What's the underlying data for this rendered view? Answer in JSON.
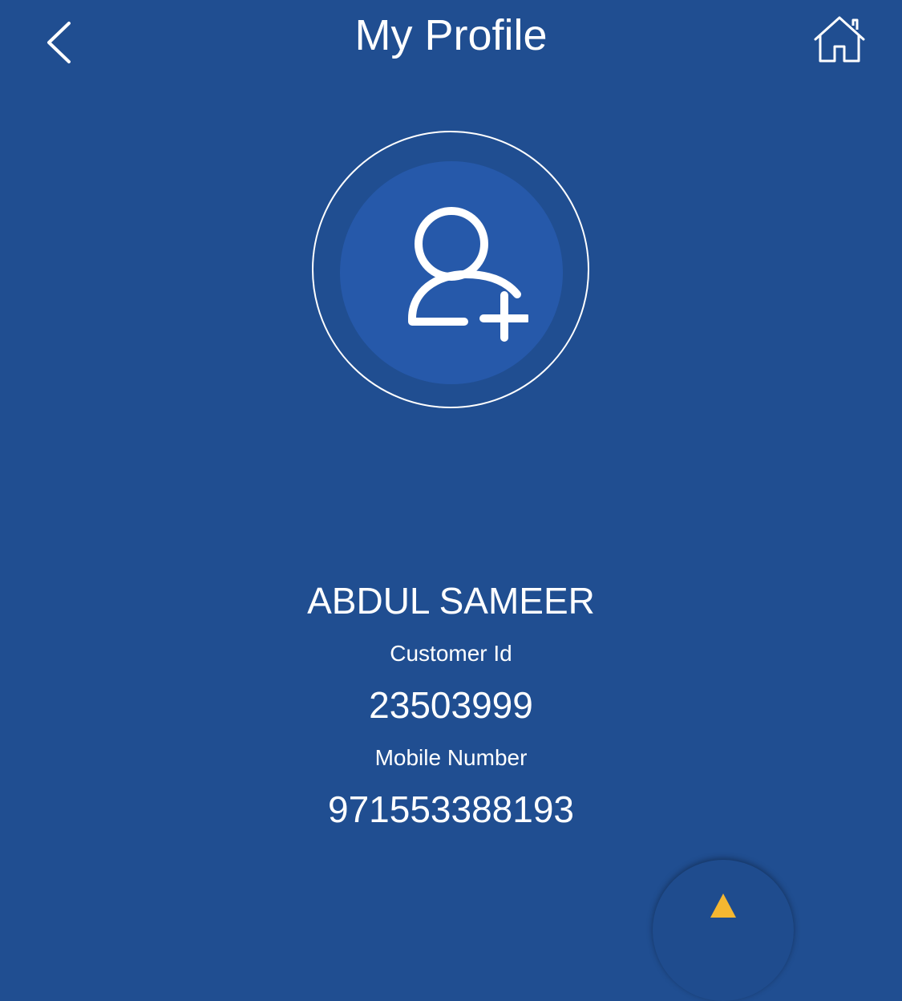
{
  "header": {
    "title": "My Profile",
    "back_icon": "chevron-left-icon",
    "home_icon": "home-icon"
  },
  "avatar": {
    "icon": "add-user-icon"
  },
  "profile": {
    "name": "ABDUL SAMEER",
    "customer_id_label": "Customer Id",
    "customer_id": "23503999",
    "mobile_label": "Mobile Number",
    "mobile": "971553388193"
  },
  "fab": {
    "icon": "arrow-up-icon"
  },
  "colors": {
    "background": "#204e91",
    "avatar_fill": "#2659aa",
    "accent": "#f5b731",
    "text": "#ffffff"
  }
}
